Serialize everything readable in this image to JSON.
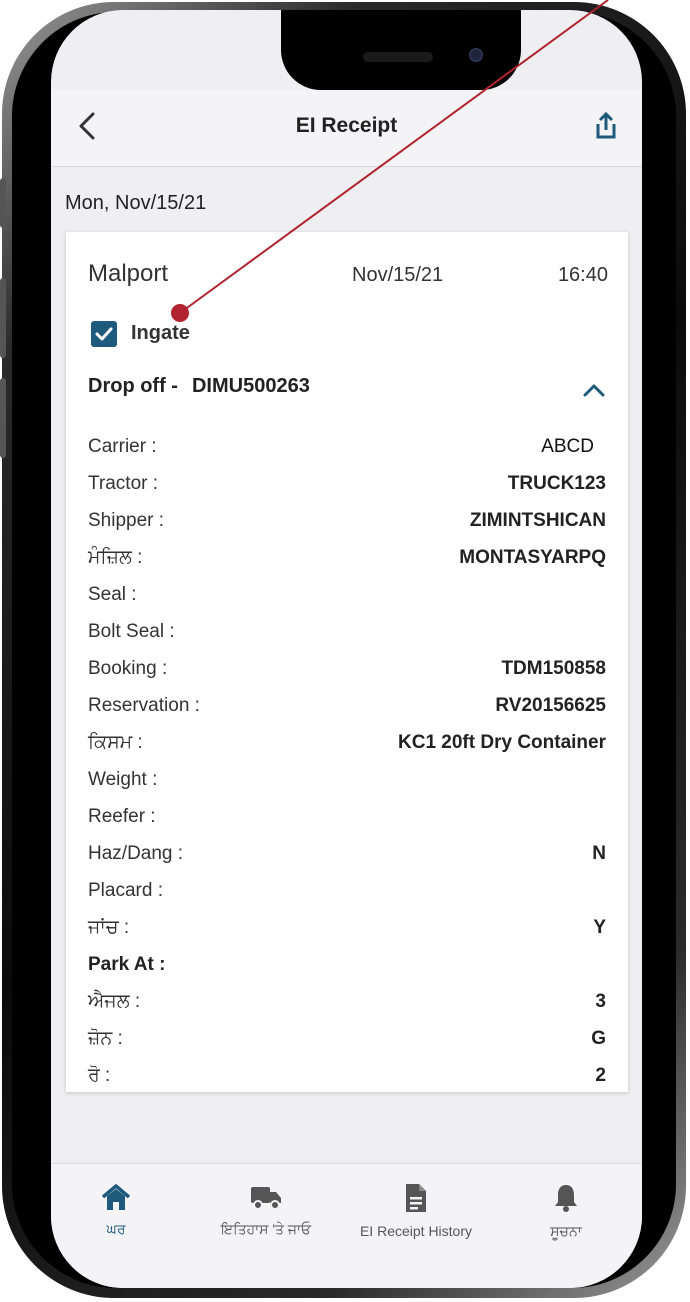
{
  "app": {
    "title": "EI Receipt"
  },
  "date_label": "Mon, Nov/15/21",
  "card": {
    "location": "Malport",
    "date": "Nov/15/21",
    "time": "16:40",
    "ingate_label": "Ingate",
    "ingate_checked": true,
    "drop_label": "Drop off -",
    "drop_container": "DIMU500263",
    "fields": [
      {
        "label": "Carrier :",
        "value": "ABCD"
      },
      {
        "label": "Tractor :",
        "value": "TRUCK123"
      },
      {
        "label": "Shipper :",
        "value": "ZIMINTSHICAN"
      },
      {
        "label": "ਮੰਜ਼ਿਲ :",
        "value": "MONTASYARPQ"
      },
      {
        "label": "Seal :",
        "value": ""
      },
      {
        "label": "Bolt Seal :",
        "value": ""
      },
      {
        "label": "Booking :",
        "value": "TDM150858"
      },
      {
        "label": "Reservation :",
        "value": "RV20156625"
      },
      {
        "label": "ਕਿਸਮ :",
        "value": "KC1 20ft Dry Container"
      },
      {
        "label": "Weight :",
        "value": ""
      },
      {
        "label": "Reefer :",
        "value": ""
      },
      {
        "label": "Haz/Dang :",
        "value": "N"
      },
      {
        "label": "Placard :",
        "value": ""
      },
      {
        "label": "ਜਾਂਚ :",
        "value": "Y"
      },
      {
        "label": "Park At :",
        "value": ""
      },
      {
        "label": "ਐਜਲ :",
        "value": "3"
      },
      {
        "label": "ਜ਼ੋਨ :",
        "value": "G"
      },
      {
        "label": "ਰੋ :",
        "value": "2"
      }
    ]
  },
  "tabs": [
    {
      "label": "ਘਰ",
      "icon": "home-icon",
      "active": true
    },
    {
      "label": "ਇਤਿਹਾਸ 'ਤੇ ਜਾਓ",
      "icon": "truck-icon",
      "active": false
    },
    {
      "label": "EI Receipt History",
      "icon": "document-icon",
      "active": false
    },
    {
      "label": "ਸੂਚਨਾ",
      "icon": "bell-icon",
      "active": false
    }
  ],
  "colors": {
    "accent": "#1d5a7c",
    "annotation": "#b0232f",
    "screen_bg": "#efeff1"
  }
}
